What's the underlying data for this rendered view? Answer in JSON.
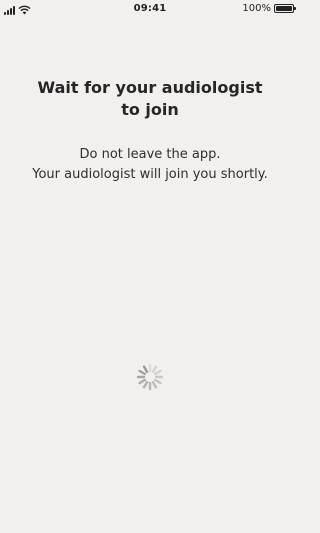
{
  "status_bar": {
    "time": "09:41",
    "battery_percent_label": "100%",
    "battery_level": 1.0,
    "signal_icon": "cellular-signal-icon",
    "wifi_icon": "wifi-icon",
    "battery_icon": "battery-icon"
  },
  "screen": {
    "title_line1": "Wait for your audiologist",
    "title_line2": "to join",
    "message_line1": "Do not leave the app.",
    "message_line2": "Your audiologist will join you shortly.",
    "loading_icon": "loading-spinner-icon"
  },
  "colors": {
    "background": "#f2f0ee",
    "text": "#262626",
    "spinner": "#9a9a9a"
  }
}
